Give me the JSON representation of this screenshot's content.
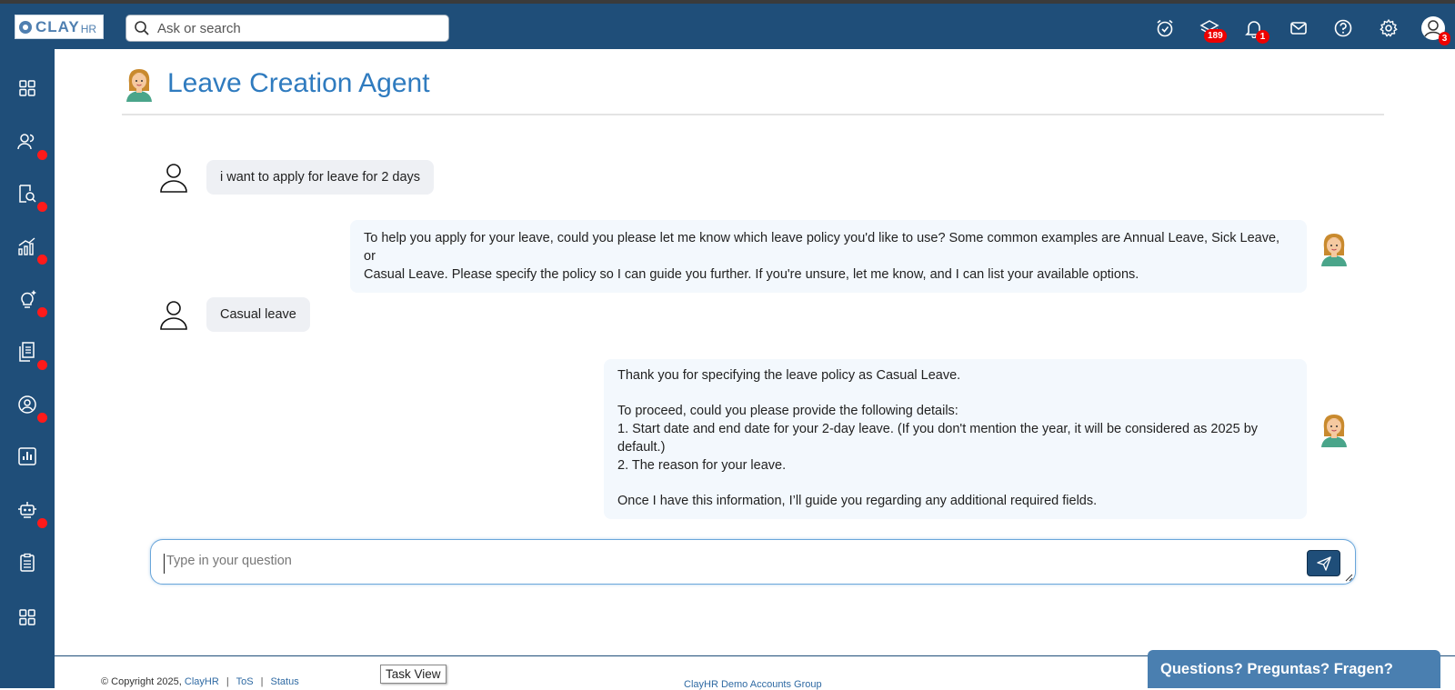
{
  "app": {
    "logo_text": "CLAY",
    "logo_suffix": "HR"
  },
  "search": {
    "placeholder": "Ask or search"
  },
  "topbar": {
    "icons": [
      {
        "name": "alarm-clock-icon"
      },
      {
        "name": "layers-icon",
        "badge": "189"
      },
      {
        "name": "bell-icon",
        "badge": "1"
      },
      {
        "name": "mail-icon"
      },
      {
        "name": "help-icon"
      },
      {
        "name": "gear-icon"
      },
      {
        "name": "user-avatar-icon",
        "badge": "3"
      }
    ]
  },
  "sidebar": {
    "items": [
      {
        "icon": "grid-icon",
        "dot": false
      },
      {
        "icon": "people-icon",
        "dot": true
      },
      {
        "icon": "document-search-icon",
        "dot": true
      },
      {
        "icon": "growth-chart-icon",
        "dot": true
      },
      {
        "icon": "lightbulb-icon",
        "dot": true
      },
      {
        "icon": "documents-icon",
        "dot": true
      },
      {
        "icon": "user-circle-icon",
        "dot": true
      },
      {
        "icon": "bar-chart-icon",
        "dot": false
      },
      {
        "icon": "robot-icon",
        "dot": true
      },
      {
        "icon": "clipboard-icon",
        "dot": false
      },
      {
        "icon": "apps-grid-icon",
        "dot": false
      }
    ]
  },
  "page": {
    "title": "Leave Creation Agent"
  },
  "chat": {
    "messages": [
      {
        "role": "user",
        "text": "i want to apply for leave for 2 days"
      },
      {
        "role": "bot",
        "lines": [
          "To help you apply for your leave, could you please let me know which leave policy you'd like to use? Some common examples are Annual Leave, Sick Leave, or",
          "Casual Leave. Please specify the policy so I can guide you further. If you're unsure, let me know, and I can list your available options."
        ]
      },
      {
        "role": "user",
        "text": "Casual leave"
      },
      {
        "role": "bot",
        "lines": [
          "Thank you for specifying the leave policy as Casual Leave.",
          "",
          "To proceed, could you please provide the following details:",
          "1. Start date and end date for your 2-day leave. (If you don't mention the year, it will be considered as 2025 by default.)",
          "2. The reason for your leave.",
          "",
          "Once I have this information, I’ll guide you regarding any additional required fields."
        ]
      }
    ]
  },
  "composer": {
    "placeholder": "Type in your question"
  },
  "footer": {
    "copyright": "© Copyright 2025,",
    "company_link": "ClayHR",
    "tos_link": "ToS",
    "status_link": "Status",
    "separator": "|",
    "center_link": "ClayHR Demo Accounts Group",
    "tooltip": "Task View",
    "help_tab": "Questions? Preguntas? Fragen?"
  },
  "colors": {
    "nav": "#1f4e79",
    "title": "#2f7bbf",
    "badge": "#ee0000"
  }
}
